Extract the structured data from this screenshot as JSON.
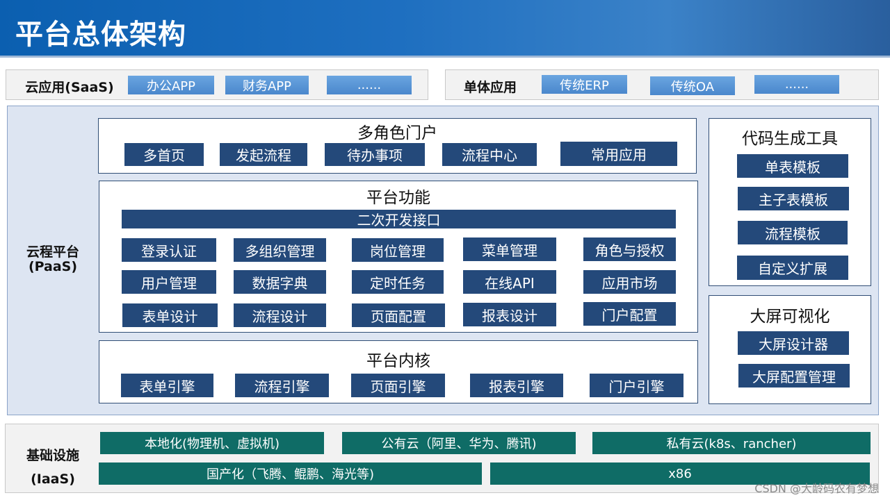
{
  "title": "平台总体架构",
  "saas": {
    "label": "云应用(SaaS)",
    "items": [
      "办公APP",
      "财务APP",
      "......"
    ]
  },
  "monolith": {
    "label": "单体应用",
    "items": [
      "传统ERP",
      "传统OA",
      "......"
    ]
  },
  "paas": {
    "label_line1": "云程平台",
    "label_line2": "(PaaS)",
    "portal": {
      "title": "多角色门户",
      "items": [
        "多首页",
        "发起流程",
        "待办事项",
        "流程中心",
        "常用应用"
      ]
    },
    "functions": {
      "title": "平台功能",
      "api_bar": "二次开发接口",
      "rows": [
        [
          "登录认证",
          "多组织管理",
          "岗位管理",
          "菜单管理",
          "角色与授权"
        ],
        [
          "用户管理",
          "数据字典",
          "定时任务",
          "在线API",
          "应用市场"
        ],
        [
          "表单设计",
          "流程设计",
          "页面配置",
          "报表设计",
          "门户配置"
        ]
      ]
    },
    "kernel": {
      "title": "平台内核",
      "items": [
        "表单引擎",
        "流程引擎",
        "页面引擎",
        "报表引擎",
        "门户引擎"
      ]
    },
    "codegen": {
      "title": "代码生成工具",
      "items": [
        "单表模板",
        "主子表模板",
        "流程模板",
        "自定义扩展"
      ]
    },
    "bigscreen": {
      "title": "大屏可视化",
      "items": [
        "大屏设计器",
        "大屏配置管理"
      ]
    }
  },
  "iaas": {
    "label_line1": "基础设施",
    "label_line2": "(IaaS)",
    "row1": [
      "本地化(物理机、虚拟机)",
      "公有云（阿里、华为、腾讯)",
      "私有云(k8s、rancher)"
    ],
    "row2": [
      "国产化（飞腾、鲲鹏、海光等)",
      "x86"
    ]
  },
  "watermark": "CSDN @大龄码农有梦想",
  "colors": {
    "header_blue": "#0b5fb0",
    "dark_navy": "#24497a",
    "teal": "#0f6c66",
    "light_blue": "#5b96d6",
    "paas_bg": "#dde5f2"
  }
}
